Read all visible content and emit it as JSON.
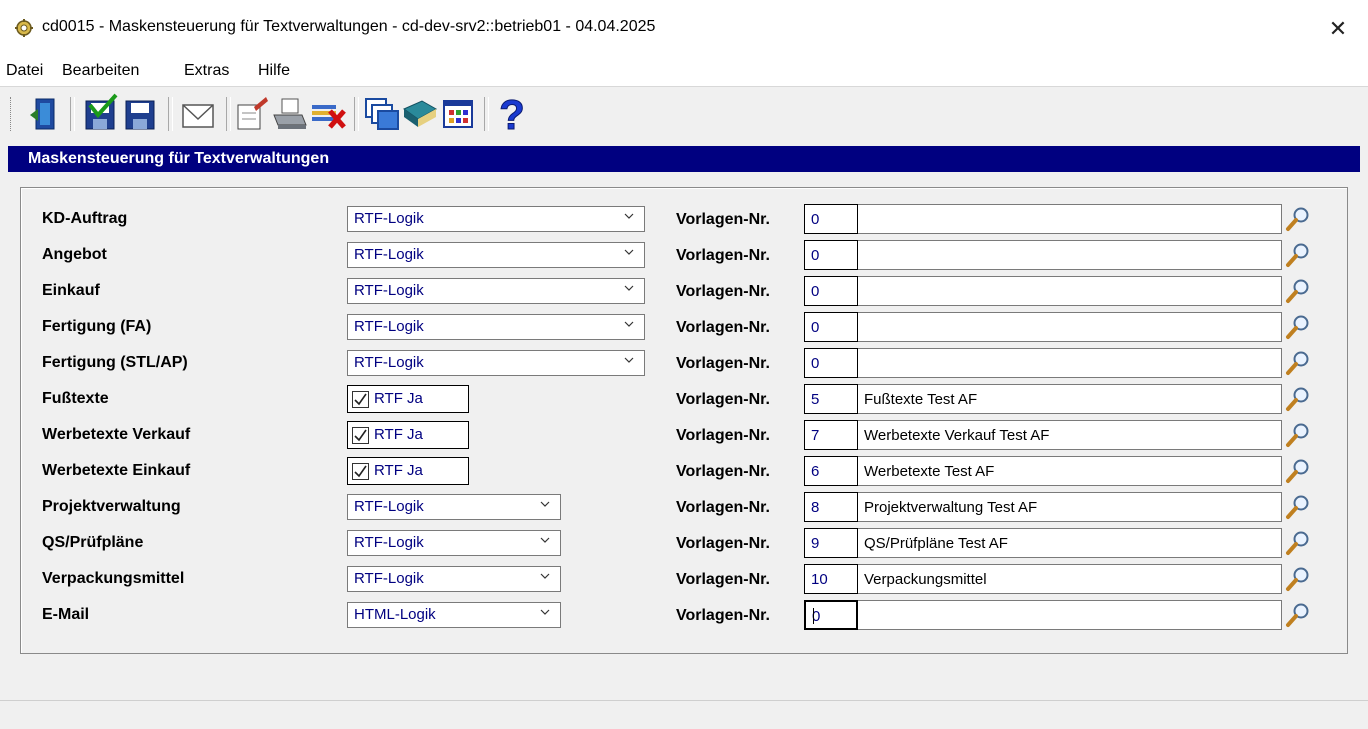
{
  "window": {
    "title": "cd0015 - Maskensteuerung für Textverwaltungen - cd-dev-srv2::betrieb01 - 04.04.2025",
    "close_glyph": "✕"
  },
  "menu": [
    "Datei",
    "Bearbeiten",
    "Extras",
    "Hilfe"
  ],
  "toolbar_icons": [
    "exit-icon",
    "save-check-icon",
    "save-icon",
    "mail-icon",
    "edit-icon",
    "print-icon",
    "delete-icon",
    "windows-icon",
    "book-icon",
    "grid-icon",
    "help-icon"
  ],
  "section_title": "Maskensteuerung für Textverwaltungen",
  "vorlagen_label": "Vorlagen-Nr.",
  "rows": [
    {
      "label": "KD-Auftrag",
      "ctrl": "combo",
      "value": "RTF-Logik",
      "num": "0",
      "desc": ""
    },
    {
      "label": "Angebot",
      "ctrl": "combo",
      "value": "RTF-Logik",
      "num": "0",
      "desc": ""
    },
    {
      "label": "Einkauf",
      "ctrl": "combo",
      "value": "RTF-Logik",
      "num": "0",
      "desc": ""
    },
    {
      "label": "Fertigung (FA)",
      "ctrl": "combo",
      "value": "RTF-Logik",
      "num": "0",
      "desc": ""
    },
    {
      "label": "Fertigung (STL/AP)",
      "ctrl": "combo",
      "value": "RTF-Logik",
      "num": "0",
      "desc": ""
    },
    {
      "label": "Fußtexte",
      "ctrl": "check",
      "value": "RTF Ja",
      "num": "5",
      "desc": "Fußtexte Test AF"
    },
    {
      "label": "Werbetexte Verkauf",
      "ctrl": "check",
      "value": "RTF Ja",
      "num": "7",
      "desc": "Werbetexte Verkauf Test AF"
    },
    {
      "label": "Werbetexte Einkauf",
      "ctrl": "check",
      "value": "RTF Ja",
      "num": "6",
      "desc": "Werbetexte Test AF"
    },
    {
      "label": "Projektverwaltung",
      "ctrl": "combo_short",
      "value": "RTF-Logik",
      "num": "8",
      "desc": "Projektverwaltung Test AF"
    },
    {
      "label": "QS/Prüfpläne",
      "ctrl": "combo_short",
      "value": "RTF-Logik",
      "num": "9",
      "desc": "QS/Prüfpläne Test AF"
    },
    {
      "label": "Verpackungsmittel",
      "ctrl": "combo_short",
      "value": "RTF-Logik",
      "num": "10",
      "desc": "Verpackungsmittel"
    },
    {
      "label": "E-Mail",
      "ctrl": "combo_short",
      "value": "HTML-Logik",
      "num": "0",
      "desc": ""
    }
  ]
}
